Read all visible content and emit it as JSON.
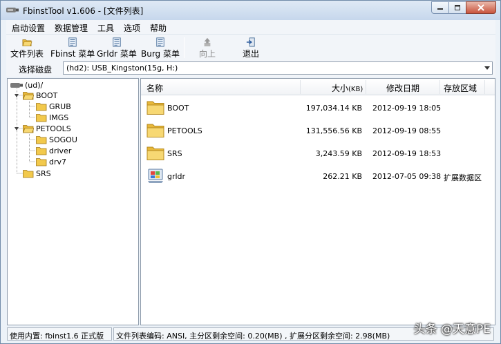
{
  "window": {
    "title": "FbinstTool v1.606 - [文件列表]"
  },
  "menu": [
    "启动设置",
    "数据管理",
    "工具",
    "选项",
    "帮助"
  ],
  "toolbar": {
    "file_list": "文件列表",
    "fbinst_menu": "Fbinst 菜单",
    "grldr_menu": "Grldr 菜单",
    "burg_menu": "Burg 菜单",
    "up": "向上",
    "exit": "退出"
  },
  "disk": {
    "label": "选择磁盘",
    "selected": "(hd2): USB_Kingston(15g, H:)"
  },
  "tree": {
    "root": "(ud)/",
    "boot": "BOOT",
    "grub": "GRUB",
    "imgs": "IMGS",
    "petools": "PETOOLS",
    "sogou": "SOGOU",
    "driver": "driver",
    "drv7": "drv7",
    "srs": "SRS"
  },
  "list": {
    "columns": {
      "name": "名称",
      "size": "大小",
      "size_unit": "(KB)",
      "modified": "修改日期",
      "region": "存放区域"
    },
    "rows": [
      {
        "name": "BOOT",
        "size": "197,034.14 KB",
        "modified": "2012-09-19 18:05",
        "region": ""
      },
      {
        "name": "PETOOLS",
        "size": "131,556.56 KB",
        "modified": "2012-09-19 08:55",
        "region": ""
      },
      {
        "name": "SRS",
        "size": "3,243.59 KB",
        "modified": "2012-09-19 18:53",
        "region": ""
      },
      {
        "name": "grldr",
        "size": "262.21 KB",
        "modified": "2012-07-05 09:38",
        "region": "扩展数据区"
      }
    ]
  },
  "status": {
    "core": "使用内置: fbinst1.6 正式版",
    "info": "文件列表编码: ANSI, 主分区剩余空间: 0.20(MB) , 扩展分区剩余空间: 2.98(MB)"
  },
  "watermark": "头条 @天意PE",
  "colors": {
    "folder": "#f2c94c",
    "titlebar": "#c6d7ec",
    "close": "#c9553d"
  }
}
